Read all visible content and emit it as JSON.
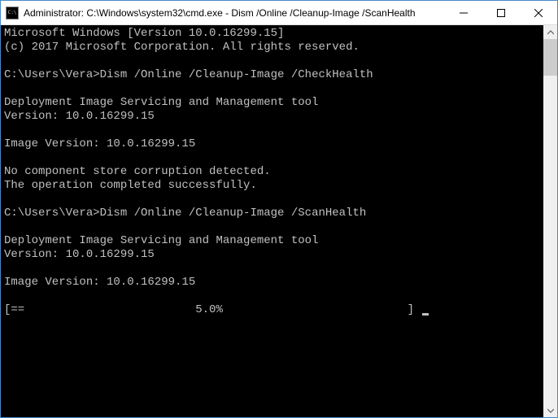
{
  "window": {
    "title": "Administrator: C:\\Windows\\system32\\cmd.exe - Dism  /Online /Cleanup-Image /ScanHealth"
  },
  "terminal": {
    "header1": "Microsoft Windows [Version 10.0.16299.15]",
    "header2": "(c) 2017 Microsoft Corporation. All rights reserved.",
    "prompt1_path": "C:\\Users\\Vera>",
    "prompt1_cmd": "Dism /Online /Cleanup-Image /CheckHealth",
    "tool_name": "Deployment Image Servicing and Management tool",
    "tool_version": "Version: 10.0.16299.15",
    "image_version": "Image Version: 10.0.16299.15",
    "result1": "No component store corruption detected.",
    "result2": "The operation completed successfully.",
    "prompt2_path": "C:\\Users\\Vera>",
    "prompt2_cmd": "Dism /Online /Cleanup-Image /ScanHealth",
    "progress_line": "[==                         5.0%                           ] "
  }
}
